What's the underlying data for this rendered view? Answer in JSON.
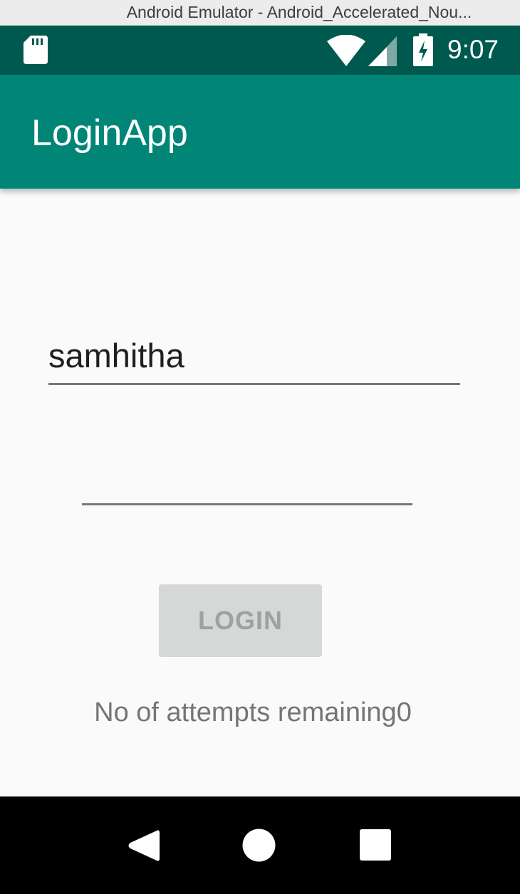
{
  "window": {
    "title": "Android Emulator - Android_Accelerated_Nou..."
  },
  "status_bar": {
    "time": "9:07",
    "icons": [
      "sd-card-icon",
      "wifi-icon",
      "signal-icon",
      "battery-charging-icon"
    ]
  },
  "app_bar": {
    "title": "LoginApp"
  },
  "form": {
    "username_value": "samhitha",
    "password_value": "",
    "login_label": "LOGIN",
    "attempts_text": "No of attempts remaining0"
  },
  "nav_bar": {
    "icons": [
      "back-icon",
      "home-icon",
      "recents-icon"
    ]
  },
  "colors": {
    "status_bar": "#00594f",
    "app_bar": "#008577",
    "background": "#fafafa",
    "button_disabled": "#d6d7d7"
  }
}
